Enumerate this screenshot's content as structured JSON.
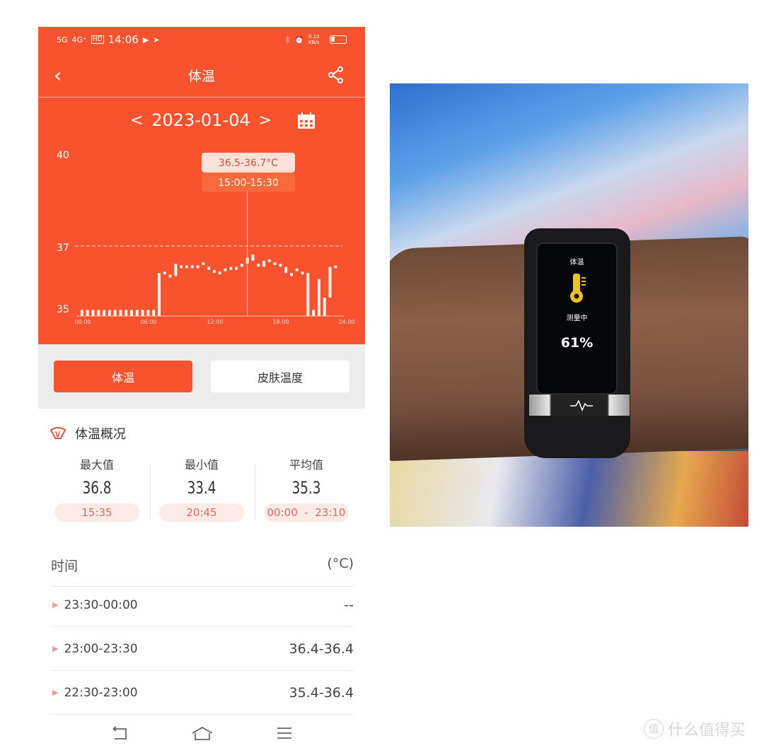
{
  "status_bar": {
    "network1": "5G",
    "network2": "4G⁺",
    "hd": "HD",
    "time": "14:06",
    "speed": "0.10 KB/s",
    "battery_percent": 25
  },
  "header": {
    "title": "体温",
    "back_icon": "chevron-left-icon",
    "share_icon": "share-icon"
  },
  "date_nav": {
    "date": "2023-01-04",
    "prev": "<",
    "next": ">",
    "calendar_icon": "calendar-icon"
  },
  "tooltip": {
    "value": "36.5-36.7°C",
    "time": "15:00-15:30"
  },
  "chart_data": {
    "type": "bar",
    "subtype": "range",
    "x_tick_labels": [
      "00:00",
      "06:00",
      "12:00",
      "18:00",
      "24:00"
    ],
    "y_tick_labels": [
      "40",
      "37",
      "35"
    ],
    "xlim": [
      "00:00",
      "24:00"
    ],
    "ylim": [
      34.8,
      40
    ],
    "reference_line": 37,
    "interval": "30 min",
    "grid": false,
    "ranges": [
      [
        34.8,
        35.0
      ],
      [
        34.8,
        35.0
      ],
      [
        34.8,
        35.0
      ],
      [
        34.8,
        35.0
      ],
      [
        34.8,
        35.0
      ],
      [
        34.8,
        35.0
      ],
      [
        34.8,
        35.0
      ],
      [
        34.8,
        35.0
      ],
      [
        34.8,
        35.0
      ],
      [
        34.8,
        35.0
      ],
      [
        34.8,
        35.0
      ],
      [
        34.8,
        35.0
      ],
      [
        34.8,
        35.0
      ],
      [
        34.8,
        35.0
      ],
      [
        34.8,
        36.2
      ],
      [
        36.2,
        36.2
      ],
      [
        36.1,
        36.1
      ],
      [
        36.1,
        36.5
      ],
      [
        36.4,
        36.4
      ],
      [
        36.4,
        36.4
      ],
      [
        36.4,
        36.4
      ],
      [
        36.4,
        36.4
      ],
      [
        36.5,
        36.5
      ],
      [
        36.3,
        36.4
      ],
      [
        36.2,
        36.3
      ],
      [
        36.2,
        36.2
      ],
      [
        36.3,
        36.3
      ],
      [
        36.3,
        36.4
      ],
      [
        36.3,
        36.4
      ],
      [
        36.4,
        36.5
      ],
      [
        36.5,
        36.7
      ],
      [
        36.6,
        36.8
      ],
      [
        36.4,
        36.5
      ],
      [
        36.4,
        36.6
      ],
      [
        36.6,
        36.6
      ],
      [
        36.5,
        36.5
      ],
      [
        36.4,
        36.5
      ],
      [
        36.2,
        36.4
      ],
      [
        36.1,
        36.2
      ],
      [
        36.3,
        36.3
      ],
      [
        36.2,
        36.2
      ],
      [
        33.4,
        36.2
      ],
      [
        34.8,
        35.0
      ],
      [
        34.8,
        36.0
      ],
      [
        34.8,
        35.4
      ],
      [
        35.4,
        36.4
      ],
      [
        36.4,
        36.4
      ],
      null
    ],
    "selected_index": 30,
    "colors": {
      "background": "#F7532F",
      "bars": "#FFF3EE"
    }
  },
  "tabs": [
    {
      "label": "体温",
      "active": true
    },
    {
      "label": "皮肤温度",
      "active": false
    }
  ],
  "summary": {
    "title": "体温概况",
    "icon": "thermometer-gauge-icon",
    "stats": [
      {
        "label": "最大值",
        "value": "36.8",
        "time": "15:35"
      },
      {
        "label": "最小值",
        "value": "33.4",
        "time": "20:45"
      },
      {
        "label": "平均值",
        "value": "35.3",
        "time": "00:00  -  23:10"
      }
    ]
  },
  "list": {
    "header_time": "时间",
    "header_unit": "(°C)",
    "rows": [
      {
        "time": "23:30-00:00",
        "value": "--"
      },
      {
        "time": "23:00-23:30",
        "value": "36.4-36.4"
      },
      {
        "time": "22:30-23:00",
        "value": "35.4-36.4"
      }
    ]
  },
  "photo": {
    "watch_title": "体温",
    "watch_status": "测量中",
    "watch_progress": "61%",
    "watch_icon": "thermometer-icon",
    "progress_percent": 61
  },
  "watermark": {
    "seal": "值",
    "text": "什么值得买"
  },
  "accent": "#F7532F"
}
